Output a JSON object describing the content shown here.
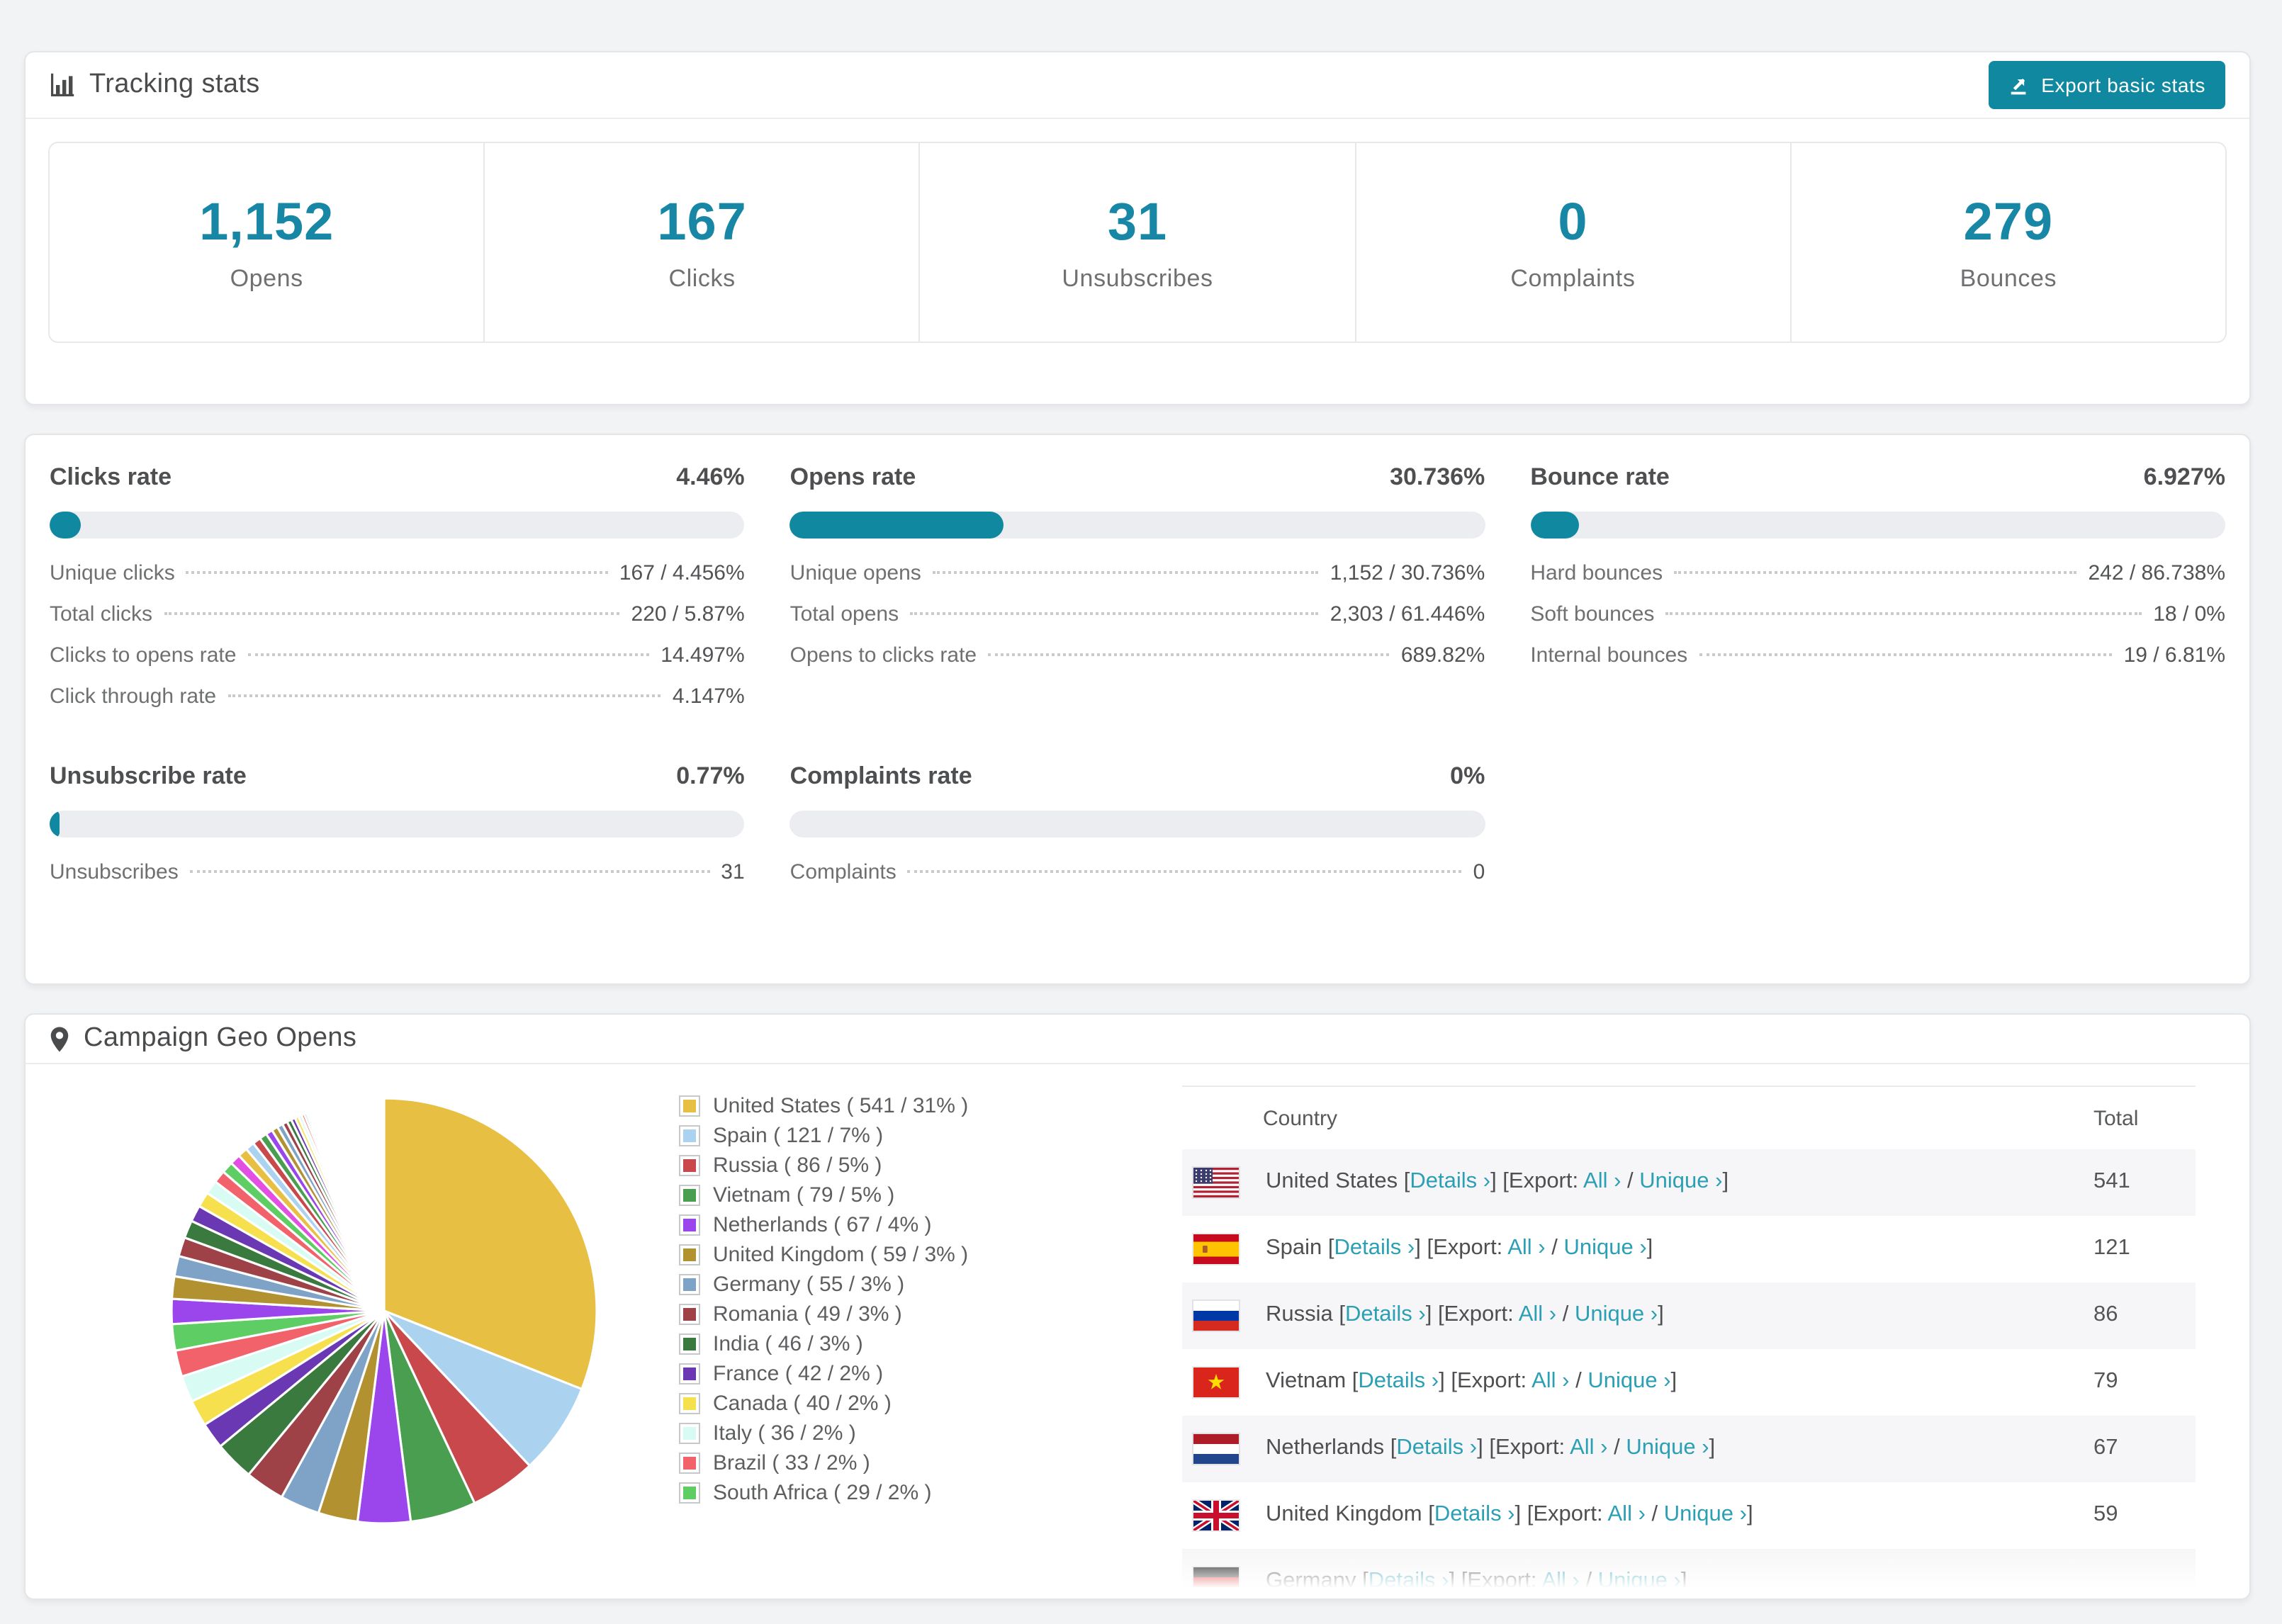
{
  "colors": {
    "teal": "#1089A0",
    "stat_number": "#1787A5",
    "link": "#2B9FB4",
    "page_bg": "#F2F3F5",
    "bar_track": "#ECEDF0",
    "row_stripe": "#F6F6F8"
  },
  "tracking": {
    "icon": "bar-chart-icon",
    "title": "Tracking stats",
    "export_button": "Export basic stats",
    "stats": [
      {
        "value": "1,152",
        "label": "Opens"
      },
      {
        "value": "167",
        "label": "Clicks"
      },
      {
        "value": "31",
        "label": "Unsubscribes"
      },
      {
        "value": "0",
        "label": "Complaints"
      },
      {
        "value": "279",
        "label": "Bounces"
      }
    ]
  },
  "rates": {
    "blocks": [
      {
        "title": "Clicks rate",
        "pct_label": "4.46%",
        "bar_pct": 4.46,
        "rows": [
          {
            "label": "Unique clicks",
            "value": "167 / 4.456%"
          },
          {
            "label": "Total clicks",
            "value": "220 / 5.87%"
          },
          {
            "label": "Clicks to opens rate",
            "value": "14.497%"
          },
          {
            "label": "Click through rate",
            "value": "4.147%"
          }
        ]
      },
      {
        "title": "Opens rate",
        "pct_label": "30.736%",
        "bar_pct": 30.736,
        "rows": [
          {
            "label": "Unique opens",
            "value": "1,152 / 30.736%"
          },
          {
            "label": "Total opens",
            "value": "2,303 / 61.446%"
          },
          {
            "label": "Opens to clicks rate",
            "value": "689.82%"
          }
        ]
      },
      {
        "title": "Bounce rate",
        "pct_label": "6.927%",
        "bar_pct": 6.927,
        "rows": [
          {
            "label": "Hard bounces",
            "value": "242 / 86.738%"
          },
          {
            "label": "Soft bounces",
            "value": "18 / 0%"
          },
          {
            "label": "Internal bounces",
            "value": "19 / 6.81%"
          }
        ]
      },
      {
        "title": "Unsubscribe rate",
        "pct_label": "0.77%",
        "bar_pct": 0.77,
        "rows": [
          {
            "label": "Unsubscribes",
            "value": "31"
          }
        ]
      },
      {
        "title": "Complaints rate",
        "pct_label": "0%",
        "bar_pct": 0,
        "rows": [
          {
            "label": "Complaints",
            "value": "0"
          }
        ]
      }
    ]
  },
  "geo": {
    "icon": "map-pin-icon",
    "title": "Campaign Geo Opens",
    "chart_data": {
      "type": "pie",
      "title": "Campaign Geo Opens",
      "legend_position": "right",
      "start": "top, clockwise",
      "labels": [
        "United States",
        "Spain",
        "Russia",
        "Vietnam",
        "Netherlands",
        "United Kingdom",
        "Germany",
        "Romania",
        "India",
        "France",
        "Canada",
        "Italy",
        "Brazil",
        "South Africa"
      ],
      "values": [
        541,
        121,
        86,
        79,
        67,
        59,
        55,
        49,
        46,
        42,
        40,
        36,
        33,
        29
      ],
      "pcts": [
        31,
        7,
        5,
        5,
        4,
        3,
        3,
        3,
        3,
        2,
        2,
        2,
        2,
        2
      ],
      "colors": [
        "#E7BF42",
        "#ABD3F0",
        "#C8484C",
        "#4A9E50",
        "#9B45ED",
        "#B29130",
        "#7FA3C6",
        "#9E4247",
        "#3A7A3E",
        "#6A38B3",
        "#F6E04E",
        "#D8FBF3",
        "#F2626B",
        "#5ECD63"
      ],
      "others_pct": [
        1.9,
        1.7,
        1.55,
        1.45,
        1.35,
        1.25,
        1.15,
        1.05,
        0.95,
        0.88,
        0.8,
        0.74,
        0.68,
        0.62,
        0.57,
        0.52,
        0.47,
        0.43,
        0.39,
        0.35,
        0.31,
        0.28,
        0.25,
        0.22,
        0.19,
        0.17,
        0.15,
        0.13,
        0.11,
        0.09,
        0.08,
        0.07,
        0.06,
        0.05,
        0.04,
        0.035,
        0.03,
        0.025,
        0.02,
        0.015
      ],
      "others_colors_cycle": [
        "#9B45ED",
        "#B29130",
        "#7FA3C6",
        "#9E4247",
        "#3A7A3E",
        "#6A38B3",
        "#F6E04E",
        "#D8FBF3",
        "#F2626B",
        "#5ECD63",
        "#E24FE2",
        "#E7BF42",
        "#ABD3F0",
        "#C8484C",
        "#4A9E50"
      ]
    },
    "legend_format": {
      "open": "( ",
      "sep": " / ",
      "close": "% )"
    },
    "table": {
      "headers": {
        "country": "Country",
        "total": "Total"
      },
      "link_labels": {
        "bracket_open": "[",
        "bracket_close": "]",
        "details": "Details ›",
        "export_prefix": "[Export:",
        "all": "All ›",
        "separator": "/",
        "unique": "Unique ›"
      },
      "rows": [
        {
          "country": "United States",
          "flag": "us",
          "total": "541"
        },
        {
          "country": "Spain",
          "flag": "es",
          "total": "121"
        },
        {
          "country": "Russia",
          "flag": "ru",
          "total": "86"
        },
        {
          "country": "Vietnam",
          "flag": "vn",
          "total": "79"
        },
        {
          "country": "Netherlands",
          "flag": "nl",
          "total": "67"
        },
        {
          "country": "United Kingdom",
          "flag": "gb",
          "total": "59"
        },
        {
          "country": "Germany",
          "flag": "de",
          "total": ""
        }
      ]
    }
  }
}
